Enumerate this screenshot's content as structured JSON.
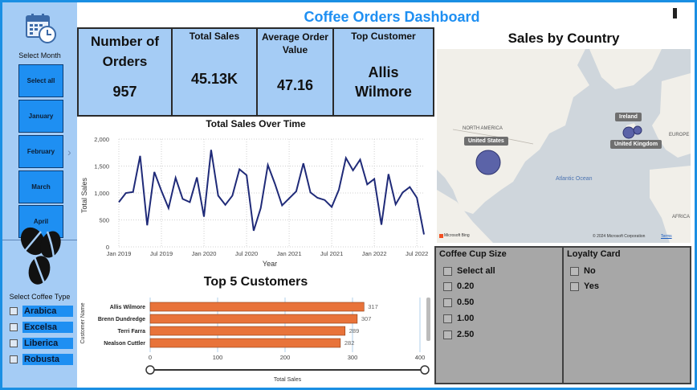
{
  "dashboard_title": "Coffee Orders Dashboard",
  "sidebar": {
    "select_month_label": "Select Month",
    "months": [
      "Select all",
      "January",
      "February",
      "March",
      "April"
    ],
    "select_coffee_type_label": "Select Coffee Type",
    "coffee_types": [
      "Arabica",
      "Excelsa",
      "Liberica",
      "Robusta"
    ]
  },
  "kpis": {
    "orders": {
      "label": "Number of Orders",
      "value": "957"
    },
    "sales": {
      "label": "Total Sales",
      "value": "45.13K"
    },
    "avg_order": {
      "label": "Average Order Value",
      "value": "47.16"
    },
    "top_customer": {
      "label": "Top Customer",
      "value": "Allis Wilmore"
    }
  },
  "line_chart": {
    "title": "Total Sales Over Time",
    "xlabel": "Year",
    "ylabel": "Total Sales",
    "yticks": [
      "0",
      "500",
      "1,000",
      "1,500",
      "2,000"
    ],
    "xticks": [
      "Jan 2019",
      "Jul 2019",
      "Jan 2020",
      "Jul 2020",
      "Jan 2021",
      "Jul 2021",
      "Jan 2022",
      "Jul 2022"
    ]
  },
  "bar_chart": {
    "title": "Top 5 Customers",
    "xlabel": "Total Sales",
    "ylabel": "Customer Name",
    "xticks": [
      "0",
      "100",
      "200",
      "300",
      "400"
    ]
  },
  "map": {
    "title": "Sales by Country",
    "region_labels": [
      "NORTH AMERICA",
      "EUROPE",
      "AFRICA",
      "Atlantic Ocean"
    ],
    "country_labels": [
      "United States",
      "Ireland",
      "United Kingdom"
    ],
    "attribution": "© 2024 Microsoft Corporation",
    "terms": "Terms",
    "bing": "Microsoft Bing"
  },
  "cup_size_slicer": {
    "title": "Coffee Cup Size",
    "options": [
      "Select all",
      "0.20",
      "0.50",
      "1.00",
      "2.50"
    ]
  },
  "loyalty_slicer": {
    "title": "Loyalty Card",
    "options": [
      "No",
      "Yes"
    ]
  },
  "colors": {
    "accent": "#1e8ff2",
    "card_bg": "#a5ccf5",
    "line": "#1f2a78",
    "bar": "#e8733a",
    "bubble": "#5b63a8",
    "slicer_bg": "#a7a7a7"
  },
  "chart_data": [
    {
      "type": "line",
      "title": "Total Sales Over Time",
      "xlabel": "Year",
      "ylabel": "Total Sales",
      "x": [
        "2019-01",
        "2019-02",
        "2019-03",
        "2019-04",
        "2019-05",
        "2019-06",
        "2019-07",
        "2019-08",
        "2019-09",
        "2019-10",
        "2019-11",
        "2019-12",
        "2020-01",
        "2020-02",
        "2020-03",
        "2020-04",
        "2020-05",
        "2020-06",
        "2020-07",
        "2020-08",
        "2020-09",
        "2020-10",
        "2020-11",
        "2020-12",
        "2021-01",
        "2021-02",
        "2021-03",
        "2021-04",
        "2021-05",
        "2021-06",
        "2021-07",
        "2021-08",
        "2021-09",
        "2021-10",
        "2021-11",
        "2021-12",
        "2022-01",
        "2022-02",
        "2022-03",
        "2022-04",
        "2022-05",
        "2022-06",
        "2022-07",
        "2022-08"
      ],
      "values": [
        830,
        1000,
        1020,
        1690,
        400,
        1390,
        1040,
        720,
        1280,
        890,
        830,
        1290,
        560,
        1800,
        950,
        780,
        950,
        1440,
        1330,
        300,
        720,
        1520,
        1170,
        770,
        900,
        1030,
        1550,
        1010,
        910,
        870,
        740,
        1060,
        1650,
        1420,
        1620,
        1160,
        1260,
        410,
        1350,
        790,
        1010,
        1110,
        910,
        230
      ],
      "ylim": [
        0,
        2000
      ]
    },
    {
      "type": "bar",
      "title": "Top 5 Customers",
      "xlabel": "Total Sales",
      "ylabel": "Customer Name",
      "categories": [
        "Allis Wilmore",
        "Brenn Dundredge",
        "Terri Farra",
        "Nealson Cuttler"
      ],
      "values": [
        317,
        307,
        289,
        282
      ],
      "xlim": [
        0,
        400
      ]
    }
  ]
}
